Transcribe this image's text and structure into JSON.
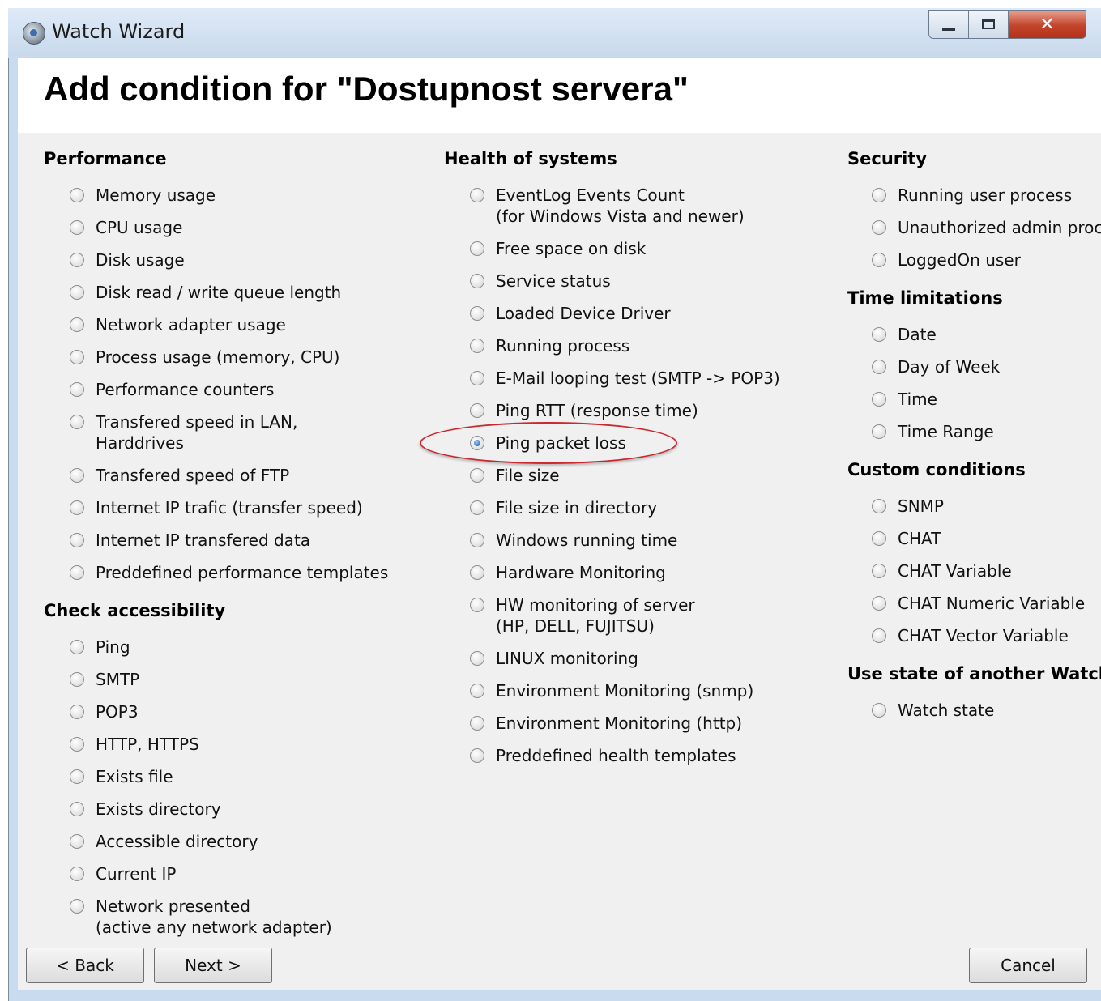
{
  "window": {
    "title": "Watch Wizard",
    "buttons": {
      "minimize": "minimize-icon",
      "maximize": "maximize-icon",
      "close": "close-icon"
    }
  },
  "header": {
    "title": "Add condition for \"Dostupnost servera\""
  },
  "columns": {
    "col1": {
      "sections": [
        {
          "title": "Performance",
          "options": [
            {
              "label": "Memory usage"
            },
            {
              "label": "CPU usage"
            },
            {
              "label": "Disk usage"
            },
            {
              "label": "Disk read / write queue length"
            },
            {
              "label": "Network adapter usage"
            },
            {
              "label": "Process usage (memory, CPU)"
            },
            {
              "label": "Performance counters"
            },
            {
              "label": "Transfered speed in LAN,",
              "label2": "Harddrives"
            },
            {
              "label": "Transfered speed of FTP"
            },
            {
              "label": "Internet IP trafic (transfer speed)"
            },
            {
              "label": "Internet IP transfered data"
            },
            {
              "label": "Preddefined performance templates"
            }
          ]
        },
        {
          "title": "Check accessibility",
          "options": [
            {
              "label": "Ping"
            },
            {
              "label": "SMTP"
            },
            {
              "label": "POP3"
            },
            {
              "label": "HTTP, HTTPS"
            },
            {
              "label": "Exists file"
            },
            {
              "label": "Exists directory"
            },
            {
              "label": "Accessible directory"
            },
            {
              "label": "Current IP"
            },
            {
              "label": "Network presented",
              "label2": "(active any network adapter)"
            }
          ]
        }
      ]
    },
    "col2": {
      "sections": [
        {
          "title": "Health of systems",
          "options": [
            {
              "label": "EventLog Events Count",
              "label2": "(for Windows Vista and newer)"
            },
            {
              "label": "Free space on disk"
            },
            {
              "label": "Service status"
            },
            {
              "label": "Loaded Device Driver"
            },
            {
              "label": "Running process"
            },
            {
              "label": "E-Mail looping test (SMTP -> POP3)"
            },
            {
              "label": "Ping RTT (response time)"
            },
            {
              "label": "Ping packet loss",
              "selected": true
            },
            {
              "label": "File size"
            },
            {
              "label": "File size in directory"
            },
            {
              "label": "Windows running time"
            },
            {
              "label": "Hardware Monitoring"
            },
            {
              "label": "HW monitoring of server",
              "label2": "(HP, DELL, FUJITSU)"
            },
            {
              "label": "LINUX monitoring"
            },
            {
              "label": "Environment Monitoring (snmp)"
            },
            {
              "label": "Environment Monitoring (http)"
            },
            {
              "label": "Preddefined health templates"
            }
          ]
        }
      ]
    },
    "col3": {
      "sections": [
        {
          "title": "Security",
          "options": [
            {
              "label": "Running user process"
            },
            {
              "label": "Unauthorized admin proce"
            },
            {
              "label": "LoggedOn user"
            }
          ]
        },
        {
          "title": "Time limitations",
          "options": [
            {
              "label": "Date"
            },
            {
              "label": "Day of Week"
            },
            {
              "label": "Time"
            },
            {
              "label": "Time Range"
            }
          ]
        },
        {
          "title": "Custom conditions",
          "options": [
            {
              "label": "SNMP"
            },
            {
              "label": "CHAT"
            },
            {
              "label": "CHAT Variable"
            },
            {
              "label": "CHAT Numeric Variable"
            },
            {
              "label": "CHAT Vector Variable"
            }
          ]
        },
        {
          "title": "Use state of another Watcl",
          "options": [
            {
              "label": "Watch state"
            }
          ]
        }
      ]
    }
  },
  "footer": {
    "back": "< Back",
    "next": "Next >",
    "cancel": "Cancel"
  },
  "colors": {
    "highlight": "#c9282f",
    "panel": "#f0f0f0",
    "titlebar": "#c9dcef"
  }
}
